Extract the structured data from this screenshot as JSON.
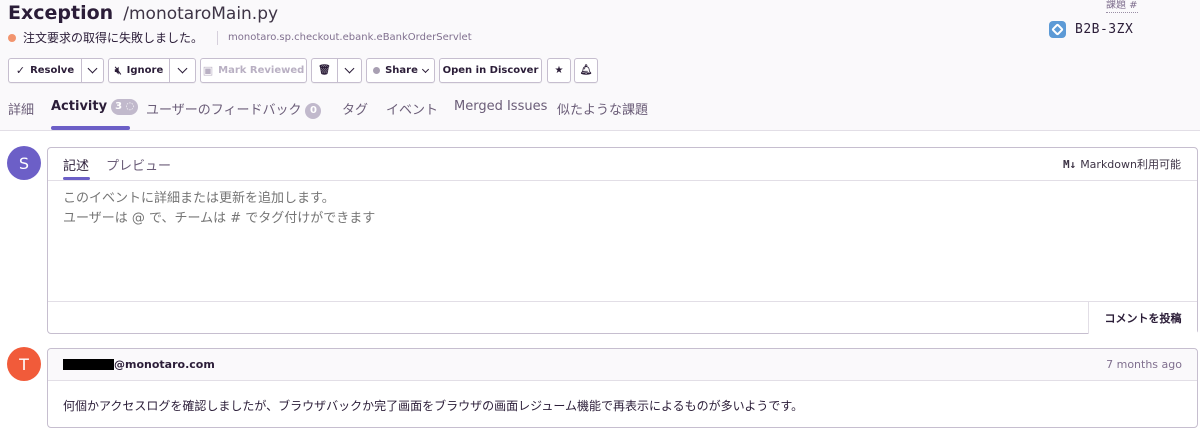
{
  "header": {
    "title": "Exception",
    "filename": "/monotaroMain.py",
    "message": "注文要求の取得に失敗しました。",
    "location": "monotaro.sp.checkout.ebank.eBankOrderServlet",
    "issue_label": "課題 #",
    "issue_short_id": "B2B-3ZX",
    "level_color": "#f2946e"
  },
  "toolbar": {
    "resolve": "Resolve",
    "ignore": "Ignore",
    "mark_reviewed": "Mark Reviewed",
    "share": "Share",
    "open_in_discover": "Open in Discover"
  },
  "tabs": {
    "details": "詳細",
    "activity": "Activity",
    "activity_count": "3",
    "user_feedback": "ユーザーのフィードバック",
    "user_feedback_count": "0",
    "tags": "タグ",
    "events": "イベント",
    "merged": "Merged Issues",
    "similar": "似たような課題"
  },
  "editor": {
    "avatar_letter": "S",
    "tab_write": "記述",
    "tab_preview": "プレビュー",
    "markdown_note": "Markdown利用可能",
    "placeholder": "このイベントに詳細または更新を追加します。\nユーザーは @ で、チームは # でタグ付けができます",
    "post_button": "コメントを投稿"
  },
  "comment": {
    "avatar_letter": "T",
    "author_domain": "@monotaro.com",
    "time": "7 months ago",
    "body": "何個かアクセスログを確認しましたが、ブラウザバックか完了画面をブラウザの画面レジューム機能で再表示によるものが多いようです。"
  },
  "colors": {
    "accent": "#6c5fc7",
    "avatar_s": "#6c5fc7",
    "avatar_t": "#f15b3a",
    "project_icon": "#5c9ad6"
  }
}
